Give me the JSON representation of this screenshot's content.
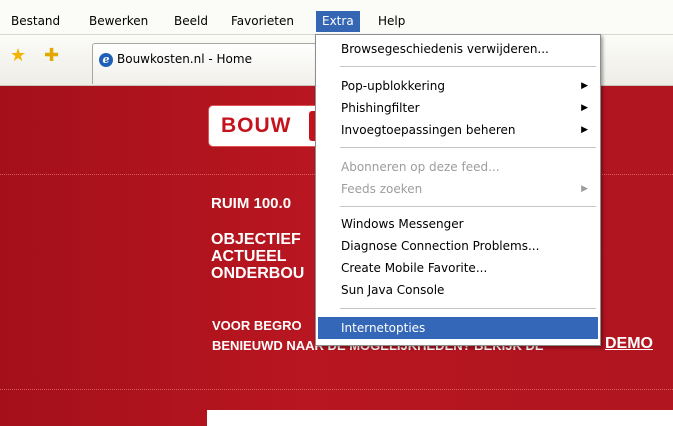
{
  "menubar": {
    "items": [
      "Bestand",
      "Bewerken",
      "Beeld",
      "Favorieten",
      "Extra",
      "Help"
    ],
    "active": "Extra"
  },
  "toolbar": {
    "tab_title": "Bouwkosten.nl - Home",
    "tab_icon": "e"
  },
  "page": {
    "logo_text": "BOUW",
    "headline_1": "RUIM 100.0",
    "headline_2": "OBJECTIEF",
    "headline_3": "ACTUEEL",
    "headline_4": "ONDERBOU",
    "tagline_1": "VOOR BEGRO",
    "tagline_2": "BENIEUWD NAAR DE MOGELIJKHEDEN? BEKIJK DE",
    "demo_link": "DEMO"
  },
  "dropdown": {
    "items": [
      {
        "label": "Browsegeschiedenis verwijderen...",
        "submenu": false,
        "disabled": false
      },
      {
        "label": "Pop-upblokkering",
        "submenu": true,
        "disabled": false
      },
      {
        "label": "Phishingfilter",
        "submenu": true,
        "disabled": false
      },
      {
        "label": "Invoegtoepassingen beheren",
        "submenu": true,
        "disabled": false
      },
      {
        "label": "Abonneren op deze feed...",
        "submenu": false,
        "disabled": true
      },
      {
        "label": "Feeds zoeken",
        "submenu": true,
        "disabled": true
      },
      {
        "label": "Windows Messenger",
        "submenu": false,
        "disabled": false
      },
      {
        "label": "Diagnose Connection Problems...",
        "submenu": false,
        "disabled": false
      },
      {
        "label": "Create Mobile Favorite...",
        "submenu": false,
        "disabled": false
      },
      {
        "label": "Sun Java Console",
        "submenu": false,
        "disabled": false
      },
      {
        "label": "Internetopties",
        "submenu": false,
        "disabled": false,
        "selected": true
      }
    ],
    "arrow_glyph": "▶"
  },
  "colors": {
    "selection": "#3467b8",
    "page_red": "#b81620"
  }
}
